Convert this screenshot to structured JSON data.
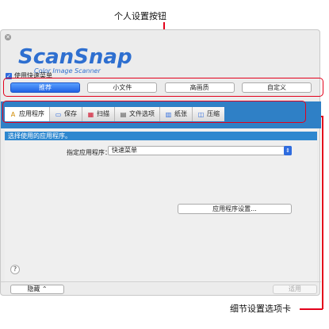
{
  "callouts": {
    "top": "个人设置按钮",
    "bottom": "细节设置选项卡"
  },
  "logo": {
    "main": "ScanSnap",
    "sub": "Color Image Scanner"
  },
  "quick_menu": {
    "label": "使用快速菜单",
    "checked": true
  },
  "presets": [
    {
      "label": "推荐",
      "active": true
    },
    {
      "label": "小文件",
      "active": false
    },
    {
      "label": "高画质",
      "active": false
    },
    {
      "label": "自定义",
      "active": false
    }
  ],
  "tabs": [
    {
      "label": "应用程序",
      "icon": "application-icon",
      "glyph": "A",
      "active": true
    },
    {
      "label": "保存",
      "icon": "save-icon",
      "glyph": "▭",
      "active": false
    },
    {
      "label": "扫描",
      "icon": "scan-icon",
      "glyph": "▦",
      "active": false
    },
    {
      "label": "文件选项",
      "icon": "file-options-icon",
      "glyph": "▤",
      "active": false
    },
    {
      "label": "纸张",
      "icon": "paper-icon",
      "glyph": "▥",
      "active": false
    },
    {
      "label": "压缩",
      "icon": "compression-icon",
      "glyph": "◫",
      "active": false
    }
  ],
  "panel": {
    "header": "选择使用的应用程序。",
    "app_label": "指定应用程序：",
    "app_value": "快速菜单",
    "settings_button": "应用程序设置..."
  },
  "footer": {
    "help": "?",
    "hide_button": "隐藏 ⌃",
    "apply_button": "适用"
  },
  "colors": {
    "accent_blue": "#2f80c6",
    "callout_red": "#e3001b"
  }
}
